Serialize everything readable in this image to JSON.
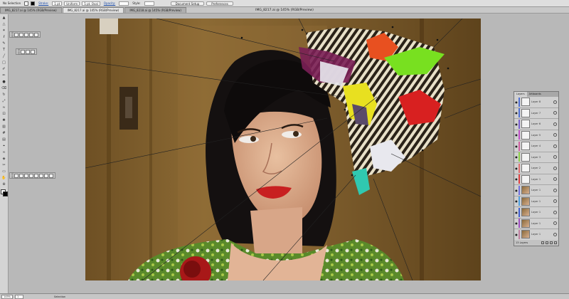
{
  "window": {
    "title": "IMG_8217.ai @ 145% (RGB/Preview)"
  },
  "control_bar": {
    "selection_label": "No Selection",
    "stroke_label": "Stroke:",
    "stroke_weight": "1 pt",
    "uniform_label": "Uniform",
    "brush_label": "5 pt. Oval",
    "opacity_label": "Opacity:",
    "style_label": "Style:",
    "doc_setup_label": "Document Setup",
    "preferences_label": "Preferences"
  },
  "tabs": [
    {
      "label": "IMG_8217.ai @ 145% (RGB/Preview)",
      "active": false
    },
    {
      "label": "IMG_8217.ai @ 145% (RGB/Preview)",
      "active": true
    },
    {
      "label": "IMG_8218.ai @ 145% (RGB/Preview)",
      "active": false
    }
  ],
  "layers_panel": {
    "tabs": [
      "Layers",
      "Artboards"
    ],
    "layers": [
      {
        "name": "Layer 8",
        "color": "#4f6fd4"
      },
      {
        "name": "Layer 7",
        "color": "#4f6fd4"
      },
      {
        "name": "Layer 6",
        "color": "#7a5fd0"
      },
      {
        "name": "Layer 5",
        "color": "#c050c8"
      },
      {
        "name": "Layer 4",
        "color": "#d060a0"
      },
      {
        "name": "Layer 3",
        "color": "#8fd24a"
      },
      {
        "name": "Layer 2",
        "color": "#e07070"
      },
      {
        "name": "Layer 1",
        "color": "#e04040"
      },
      {
        "name": "Layer 1",
        "color": "#7070e0"
      },
      {
        "name": "Layer 1",
        "color": "#50a0e0"
      },
      {
        "name": "Layer 1",
        "color": "#4060d0"
      },
      {
        "name": "Layer 1",
        "color": "#a050c0"
      },
      {
        "name": "Layer 1",
        "color": "#c080a0"
      }
    ],
    "footer_count": "13 Layers"
  },
  "status_bar": {
    "zoom": "145%",
    "page": "1",
    "tool_label": "Selection"
  },
  "icons": {
    "tools": [
      "selection-arrow",
      "direct-selection",
      "magic-wand",
      "lasso",
      "pen",
      "type",
      "line-segment",
      "rectangle",
      "paintbrush",
      "pencil",
      "blob-brush",
      "eraser",
      "rotate",
      "scale",
      "warp",
      "free-transform",
      "symbol-sprayer",
      "column-graph",
      "mesh",
      "gradient",
      "eyedropper",
      "blend",
      "live-paint",
      "slice",
      "artboard",
      "hand",
      "zoom"
    ]
  }
}
